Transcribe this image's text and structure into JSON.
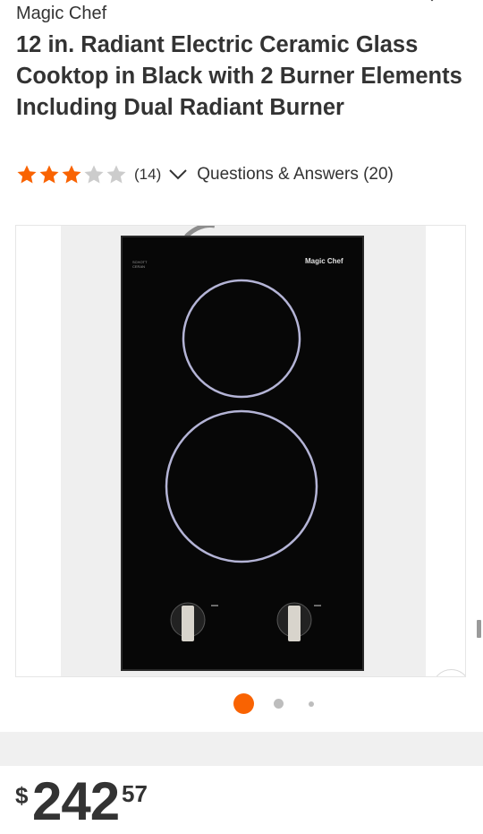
{
  "product": {
    "brand": "Magic Chef",
    "title": "12 in. Radiant Electric Ceramic Glass Cooktop in Black with 2 Burner Elements Including Dual Radiant Burner",
    "rating": {
      "stars_filled": 3,
      "stars_total": 5,
      "review_count": "(14)"
    },
    "qa_link": "Questions & Answers (20)",
    "image_brand_mark": "Magic Chef",
    "price": {
      "symbol": "$",
      "dollars": "242",
      "cents": "57"
    }
  },
  "gallery": {
    "current_slide": 1,
    "total_dots": 3
  },
  "colors": {
    "accent": "#f96302",
    "text": "#333333",
    "star_empty": "#cccccc"
  },
  "icons": [
    "chevron-down-icon",
    "star-icon",
    "chevron-right-icon"
  ]
}
